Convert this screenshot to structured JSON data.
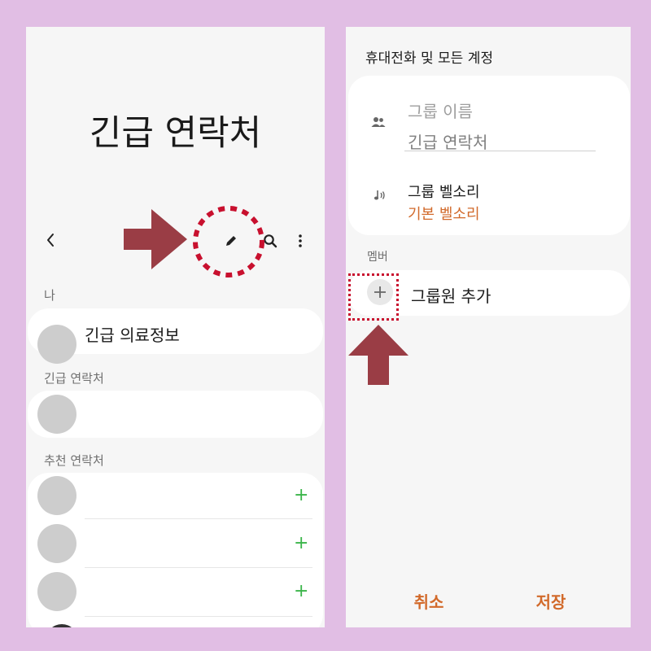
{
  "left": {
    "title": "긴급 연락처",
    "me_section": "나",
    "medical_info": "긴급 의료정보",
    "emergency_section": "긴급 연락처",
    "suggested_section": "추천 연락처",
    "add_symbol": "+"
  },
  "right": {
    "account": "휴대전화 및 모든 계정",
    "group_name_placeholder": "그룹 이름",
    "group_name_value": "긴급 연락처",
    "ringtone_label": "그룹 벨소리",
    "ringtone_value": "기본 벨소리",
    "members_section": "멤버",
    "add_member": "그룹원 추가",
    "cancel": "취소",
    "save": "저장"
  },
  "colors": {
    "background": "#e1bee4",
    "accent_orange": "#d26a2b",
    "annotation_red": "#c8102e",
    "arrow": "#9a3d45",
    "add_green": "#3bb54a"
  }
}
